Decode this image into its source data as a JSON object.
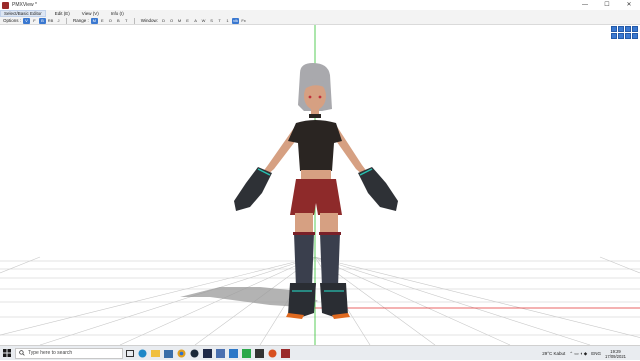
{
  "window": {
    "title": "PMXView *",
    "controls": {
      "minimize": "—",
      "maximize": "☐",
      "close": "✕"
    }
  },
  "menubar": {
    "items": [
      {
        "label": "Select/Basic Editor"
      },
      {
        "label": "Edit (E)"
      },
      {
        "label": "View (V)"
      },
      {
        "label": "Info (I)"
      }
    ]
  },
  "toolbar": {
    "options_label": "Options :",
    "options_buttons": [
      "V",
      "F",
      "B",
      "RB",
      "J"
    ],
    "range_label": "Range :",
    "range_buttons": [
      "M",
      "E",
      "O",
      "B",
      "T"
    ],
    "window_label": "Window:",
    "window_buttons": [
      "D",
      "O",
      "M",
      "E",
      "A",
      "W",
      "S",
      "T",
      "1"
    ],
    "extra": [
      "vik",
      "Fx"
    ]
  },
  "taskbar": {
    "search_placeholder": "Type here to search",
    "weather": "29°C  Kabut",
    "lang": "ENG",
    "time": "19:29",
    "date": "17/09/2021"
  },
  "colors": {
    "accent": "#3a78d0",
    "x_axis": "#e03030",
    "y_axis": "#30c030",
    "grid": "#c8c8c8"
  }
}
